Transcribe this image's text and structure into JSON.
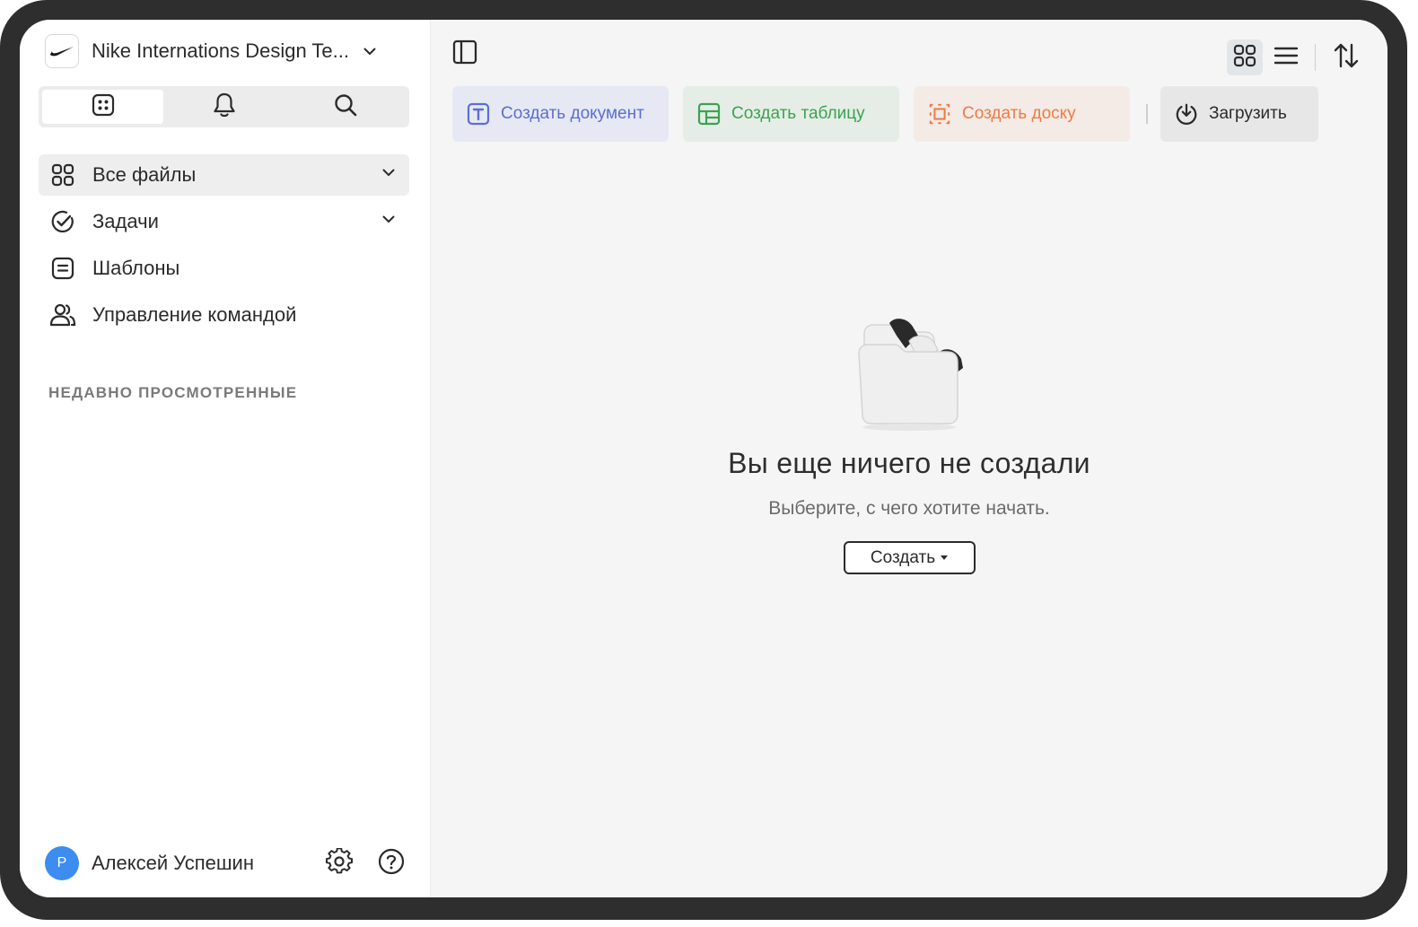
{
  "sidebar": {
    "team_name": "Nike Internations Design Te...",
    "nav": [
      {
        "label": "Все файлы",
        "icon": "grid-icon",
        "active": true,
        "expandable": true
      },
      {
        "label": "Задачи",
        "icon": "check-circle-icon",
        "active": false,
        "expandable": true
      },
      {
        "label": "Шаблоны",
        "icon": "template-icon",
        "active": false,
        "expandable": false
      },
      {
        "label": "Управление командой",
        "icon": "team-icon",
        "active": false,
        "expandable": false
      }
    ],
    "recent_title": "НЕДАВНО ПРОСМОТРЕННЫЕ",
    "user": {
      "initial": "Р",
      "name": "Алексей Успешин"
    }
  },
  "main": {
    "actions": [
      {
        "label": "Создать документ",
        "icon": "document-icon",
        "color": "#5b6fd0"
      },
      {
        "label": "Создать таблицу",
        "icon": "table-icon",
        "color": "#3aa352"
      },
      {
        "label": "Создать доску",
        "icon": "board-icon",
        "color": "#ef7b45"
      },
      {
        "label": "Загрузить",
        "icon": "upload-icon",
        "color": "#2b2b2b"
      }
    ],
    "empty": {
      "title": "Вы еще ничего не создали",
      "subtitle": "Выберите, с чего хотите начать.",
      "create_label": "Создать"
    }
  },
  "colors": {
    "avatar": "#3d8cf0",
    "active_view": "#e2e6e8"
  }
}
